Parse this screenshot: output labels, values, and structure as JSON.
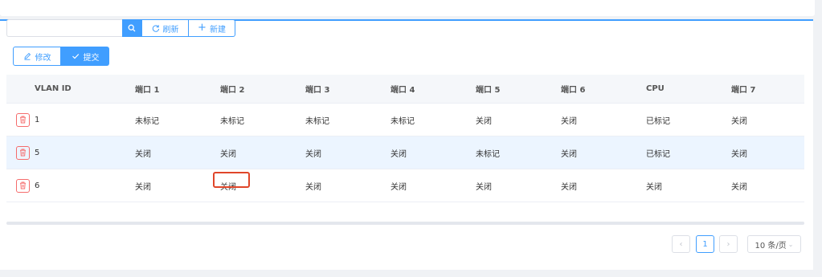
{
  "toolbar": {
    "search_value": "",
    "refresh_label": "刷新",
    "new_label": "新建",
    "edit_label": "修改",
    "submit_label": "提交"
  },
  "table": {
    "headers": [
      "VLAN ID",
      "端口 1",
      "端口 2",
      "端口 3",
      "端口 4",
      "端口 5",
      "端口 6",
      "CPU",
      "端口 7"
    ],
    "rows": [
      {
        "vlan_id": "1",
        "cells": [
          "未标记",
          "未标记",
          "未标记",
          "未标记",
          "关闭",
          "关闭",
          "已标记",
          "关闭"
        ]
      },
      {
        "vlan_id": "5",
        "cells": [
          "关闭",
          "关闭",
          "关闭",
          "关闭",
          "未标记",
          "关闭",
          "已标记",
          "关闭"
        ]
      },
      {
        "vlan_id": "6",
        "cells": [
          "关闭",
          "关闭",
          "关闭",
          "关闭",
          "关闭",
          "关闭",
          "关闭",
          "关闭"
        ]
      }
    ]
  },
  "pagination": {
    "current_page": "1",
    "page_size": "10 条/页"
  },
  "colors": {
    "accent": "#409eff",
    "selected_row": "#ecf5ff",
    "delete": "#f56c6c",
    "highlight": "#e0462a"
  }
}
